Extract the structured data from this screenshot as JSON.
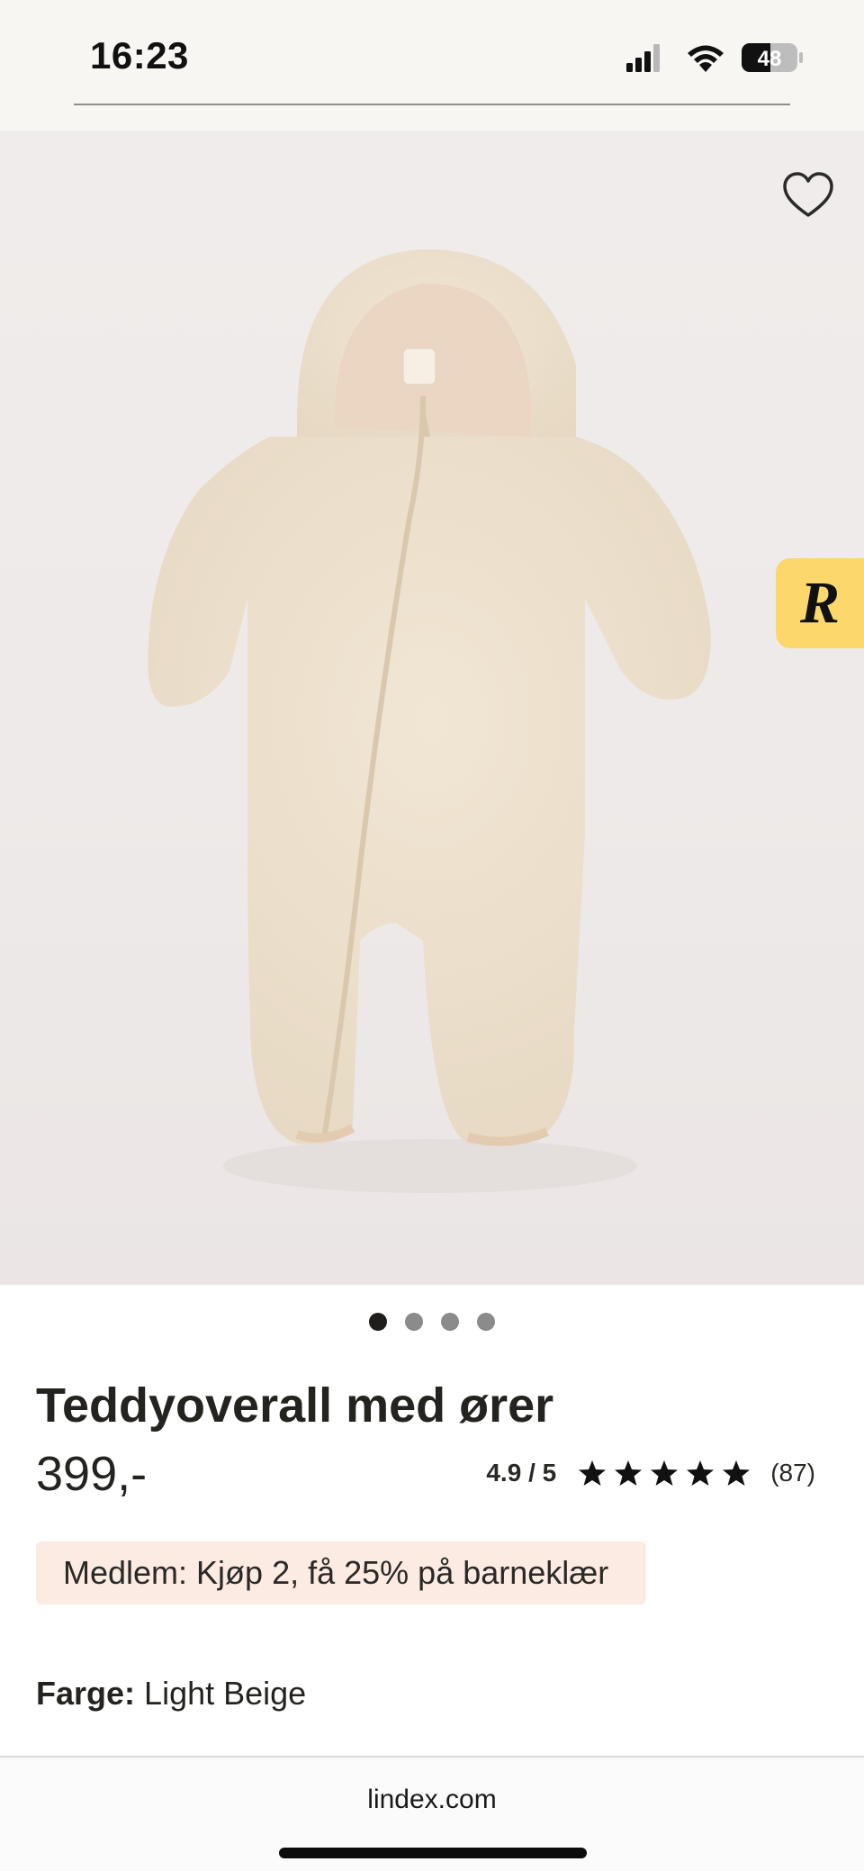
{
  "status_bar": {
    "time": "16:23",
    "battery": "48",
    "icons": [
      "signal-icon",
      "wifi-icon",
      "battery-icon"
    ]
  },
  "product": {
    "image_icons": [
      "heart-icon"
    ],
    "badge_letter": "R",
    "carousel": {
      "total": 4,
      "active": 1
    },
    "title": "Teddyoverall med ører",
    "price": "399,-",
    "rating": {
      "score_text": "4.9 / 5",
      "value": 4.9,
      "max": 5,
      "count_text": "(87)"
    },
    "promo": "Medlem: Kjøp 2, få 25% på barneklær",
    "color_label": "Farge:",
    "color_value": "Light Beige"
  },
  "browser": {
    "url": "lindex.com"
  },
  "colors": {
    "promo_bg": "#fbebe3",
    "badge_bg": "#fbd76c",
    "text_primary": "#24231f"
  }
}
